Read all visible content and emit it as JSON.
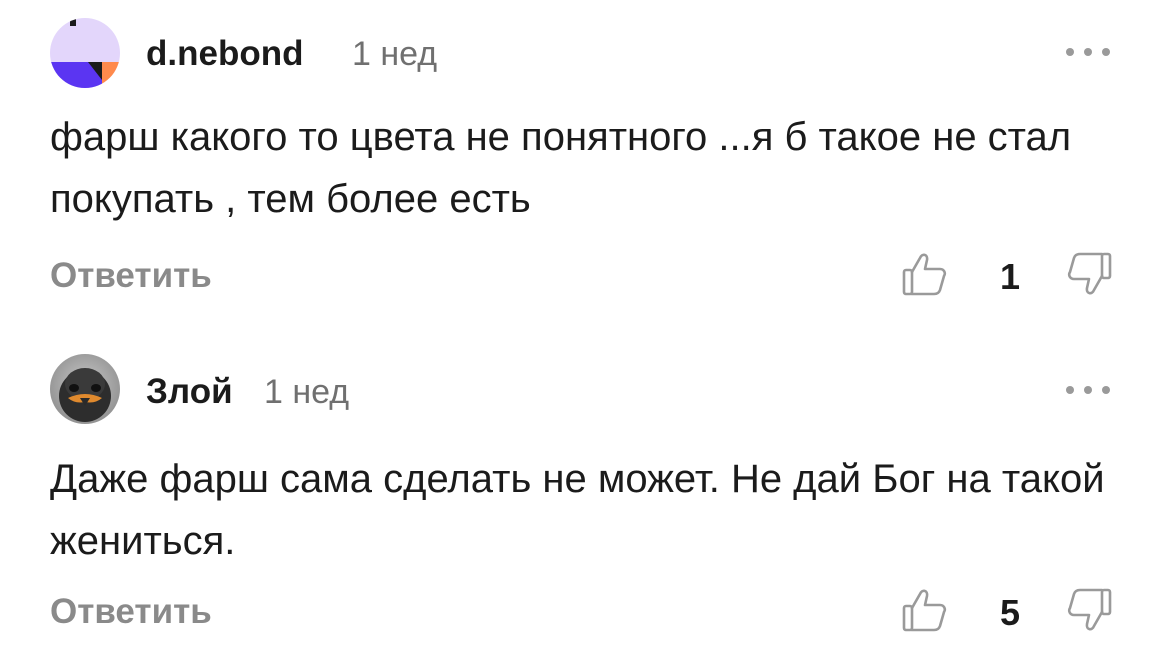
{
  "comments": [
    {
      "author": "d.nebond",
      "time": "1 нед",
      "text": "фарш какого то цвета не понятного ...я б такое не стал покупать , тем более есть",
      "reply_label": "Ответить",
      "likes": "1",
      "avatar_icon": "abstract-avatar-icon"
    },
    {
      "author": "Злой",
      "time": "1 нед",
      "text": "Даже фарш сама сделать не может. Не дай Бог на такой жениться.",
      "reply_label": "Ответить",
      "likes": "5",
      "avatar_icon": "bird-avatar-icon"
    }
  ],
  "colors": {
    "avatar1_bg": "#e3d6fb",
    "avatar1_blue": "#5b35f2",
    "avatar1_orange": "#ff8a4c",
    "secondary_text": "#707070",
    "reply_text": "#8a8a8a",
    "icon_gray": "#9a9a9a"
  }
}
